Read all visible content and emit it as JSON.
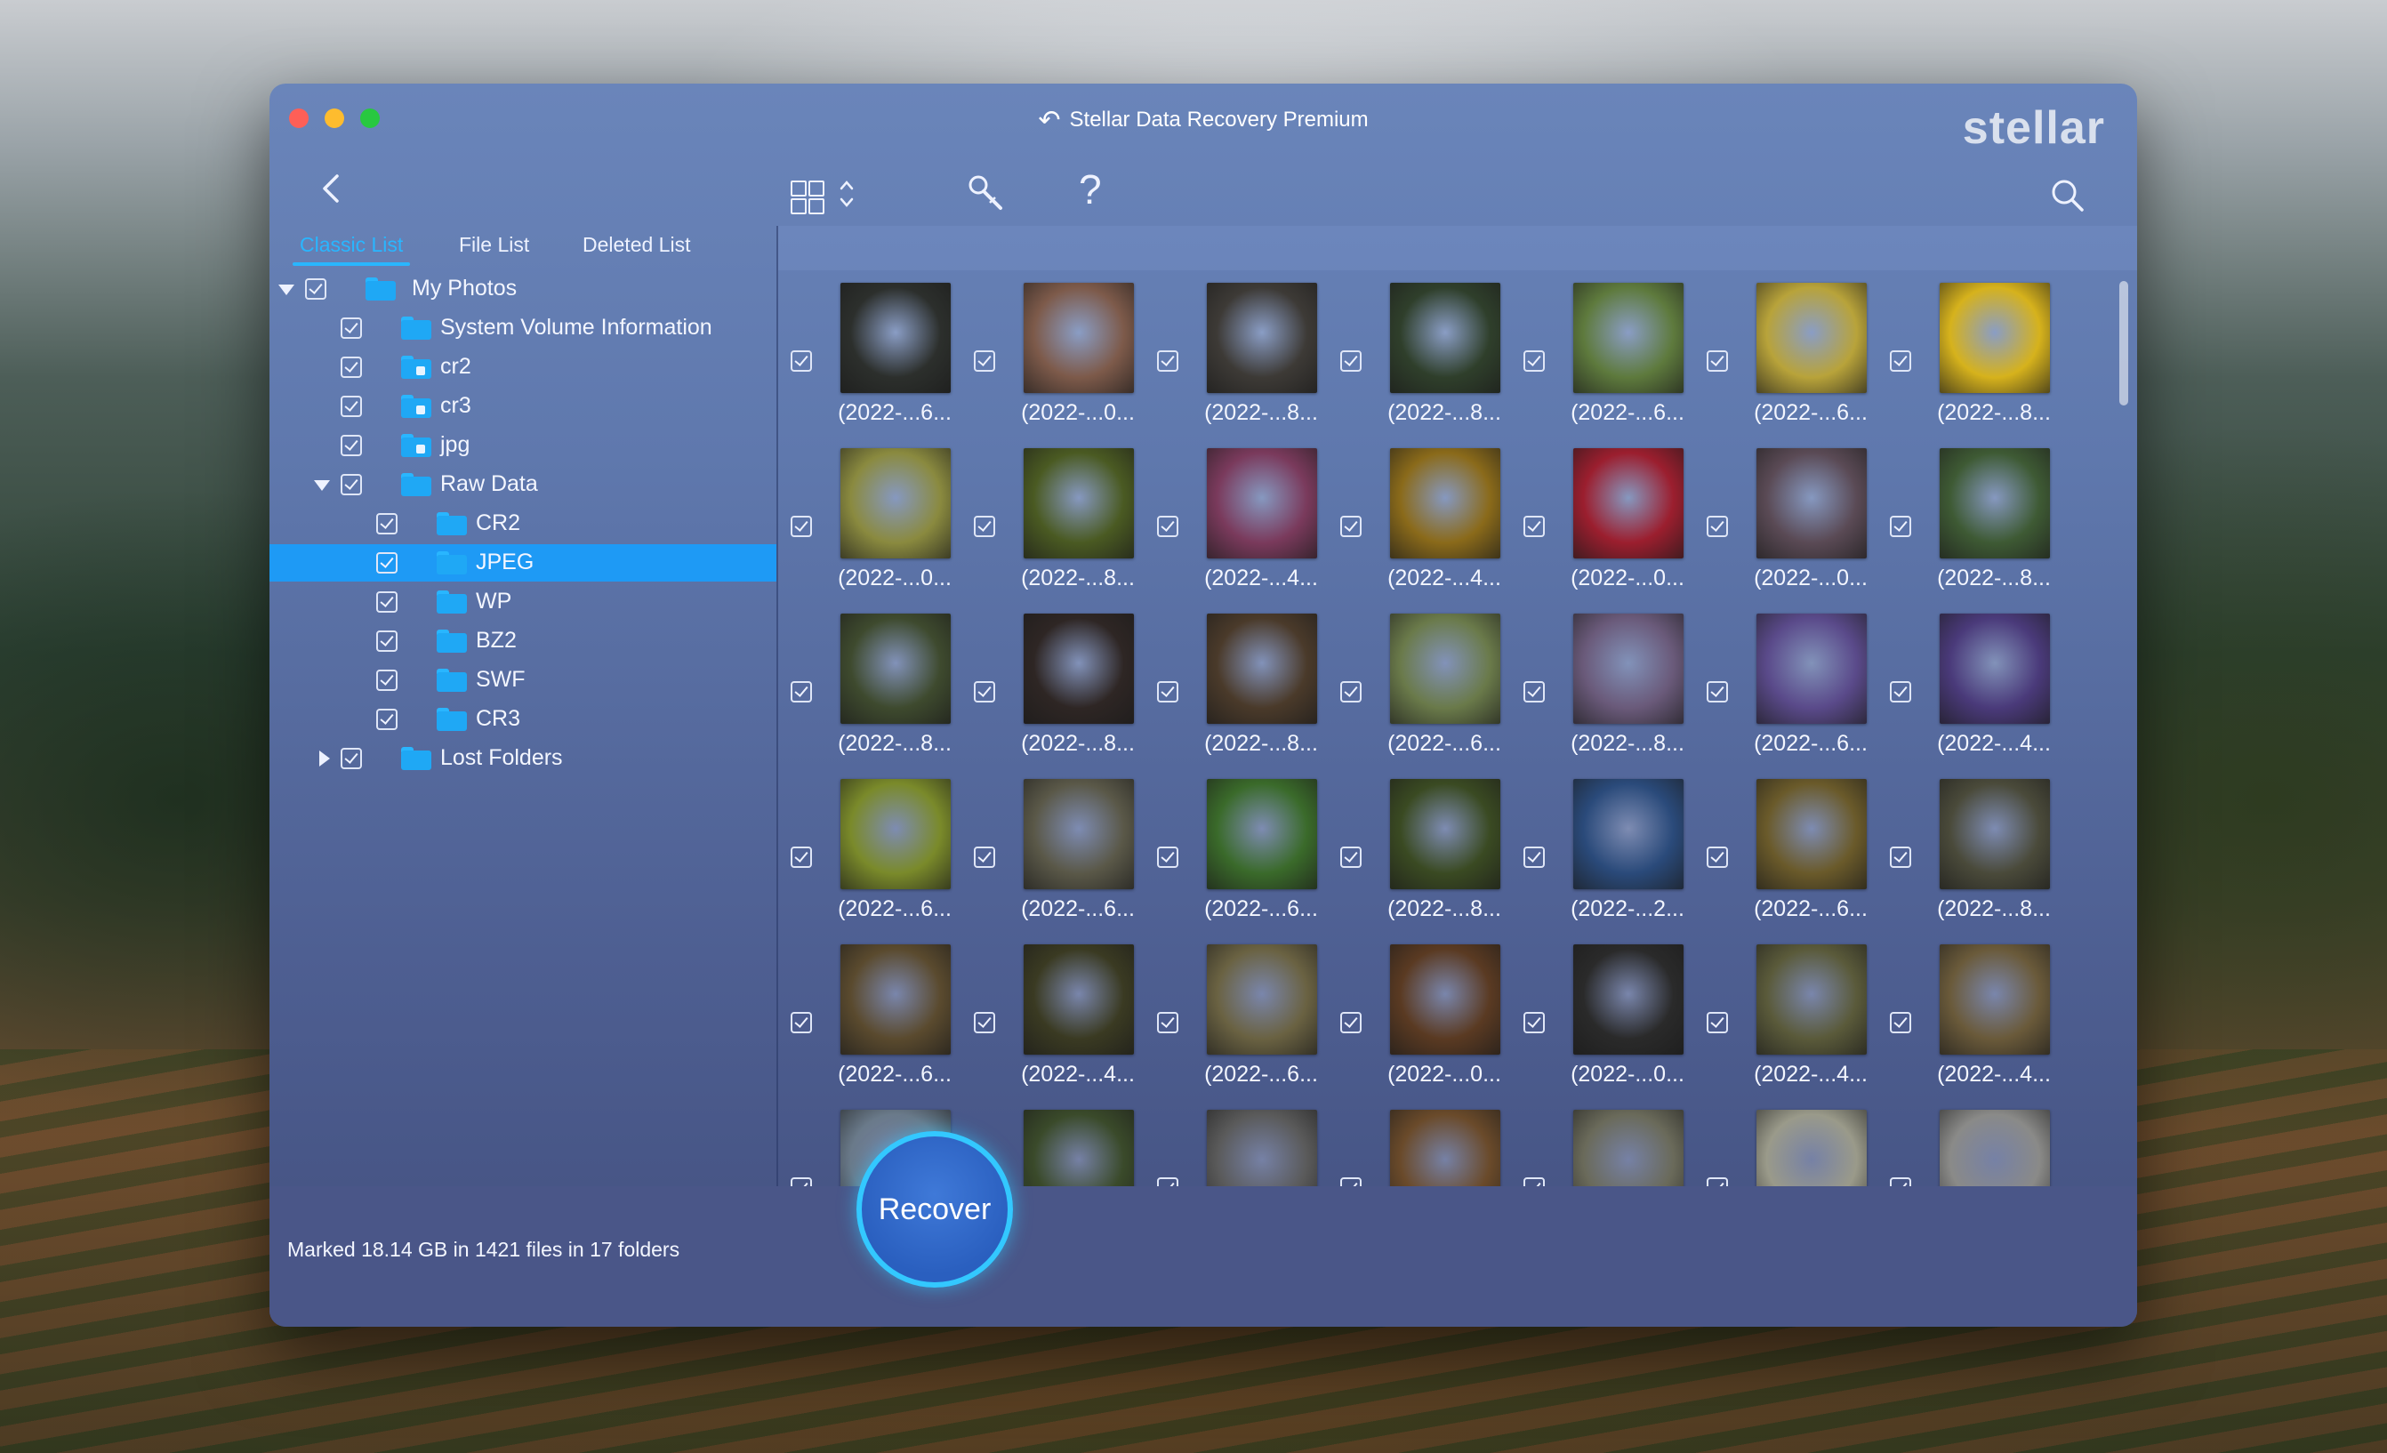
{
  "window": {
    "title": "Stellar Data Recovery Premium",
    "brand": "stellar"
  },
  "toolbar": {
    "icons": [
      "back-chevron-icon",
      "grid-view-icon",
      "sort-arrows-icon",
      "deep-scan-tool-icon",
      "help-icon",
      "search-icon"
    ],
    "help_label": "?"
  },
  "tabs": [
    {
      "label": "Classic List",
      "active": true
    },
    {
      "label": "File List",
      "active": false
    },
    {
      "label": "Deleted List",
      "active": false
    }
  ],
  "tree": [
    {
      "label": "My Photos",
      "expanded": true
    },
    {
      "label": "System Volume Information"
    },
    {
      "label": "cr2"
    },
    {
      "label": "cr3"
    },
    {
      "label": "jpg"
    },
    {
      "label": "Raw Data",
      "expanded": true
    },
    {
      "label": "CR2"
    },
    {
      "label": "JPEG",
      "selected": true
    },
    {
      "label": "WP"
    },
    {
      "label": "BZ2"
    },
    {
      "label": "SWF"
    },
    {
      "label": "CR3"
    },
    {
      "label": "Lost Folders",
      "expanded": false
    }
  ],
  "gallery": {
    "rows": [
      [
        "(2022-...6...",
        "(2022-...0...",
        "(2022-...8...",
        "(2022-...8...",
        "(2022-...6...",
        "(2022-...6...",
        "(2022-...8..."
      ],
      [
        "(2022-...0...",
        "(2022-...8...",
        "(2022-...4...",
        "(2022-...4...",
        "(2022-...0...",
        "(2022-...0...",
        "(2022-...8..."
      ],
      [
        "(2022-...8...",
        "(2022-...8...",
        "(2022-...8...",
        "(2022-...6...",
        "(2022-...8...",
        "(2022-...6...",
        "(2022-...4..."
      ],
      [
        "(2022-...6...",
        "(2022-...6...",
        "(2022-...6...",
        "(2022-...8...",
        "(2022-...2...",
        "(2022-...6...",
        "(2022-...8..."
      ],
      [
        "(2022-...6...",
        "(2022-...4...",
        "(2022-...6...",
        "(2022-...0...",
        "(2022-...0...",
        "(2022-...4...",
        "(2022-...4..."
      ],
      [
        "",
        "",
        "",
        "",
        "",
        "",
        ""
      ]
    ],
    "thumb_colors": [
      [
        "#2c2f2c",
        "#7d5a4a",
        "#3d3a36",
        "#2f3f2b",
        "#5e7a3d",
        "#b8a33a",
        "#d6b21c"
      ],
      [
        "#8a8a3f",
        "#4a5a22",
        "#7a3a5c",
        "#8a6a1a",
        "#9b1e2e",
        "#5a4a55",
        "#3e5a34"
      ],
      [
        "#3e4a2e",
        "#2e2624",
        "#4a3a2a",
        "#6a7a4a",
        "#6a5a7a",
        "#5a4a8a",
        "#4a3a7a"
      ],
      [
        "#7a8a2a",
        "#5a5848",
        "#3a6a2a",
        "#3a4a22",
        "#2a4a7a",
        "#6a5a2a",
        "#4a4a3a"
      ],
      [
        "#5a4a2e",
        "#3a3a22",
        "#6a6242",
        "#5a3a22",
        "#2a2a2a",
        "#5a5a3a",
        "#6a5a3a"
      ],
      [
        "#6a7a8a",
        "#3a4a2a",
        "#5a5a5a",
        "#6a4a2a",
        "#6a6a5a",
        "#9a9a8a",
        "#8a8a88"
      ]
    ]
  },
  "footer": {
    "status": "Marked 18.14 GB in 1421 files in 17 folders",
    "recover_label": "Recover"
  },
  "colors": {
    "accent": "#29b6ff",
    "selection": "#1e9af5",
    "window_bg": "#5f78ad"
  }
}
